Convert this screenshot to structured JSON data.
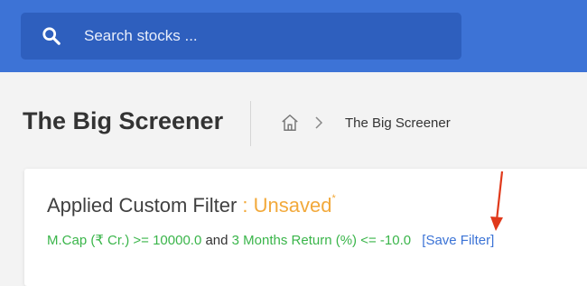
{
  "search": {
    "placeholder": "Search stocks ..."
  },
  "header": {
    "title": "The Big Screener"
  },
  "breadcrumb": {
    "current": "The Big Screener"
  },
  "filter": {
    "heading": "Applied Custom Filter",
    "separator": " : ",
    "status": "Unsaved",
    "status_marker": "*",
    "criteria_1": "M.Cap (₹ Cr.) >= 10000.0",
    "joiner": "and",
    "criteria_2": "3 Months Return (%) <= -10.0",
    "save_link": "[Save Filter]"
  },
  "colors": {
    "topbar": "#3d73d6",
    "search_bg": "#2e5fbe",
    "status": "#f2a93b",
    "criteria": "#3ab54a",
    "link": "#3b73d6",
    "annotation_arrow": "#e0391b"
  },
  "icons": {
    "search": "search-icon",
    "home": "home-icon",
    "separator": "chevron-right-icon",
    "annotation": "arrow-down-icon"
  }
}
